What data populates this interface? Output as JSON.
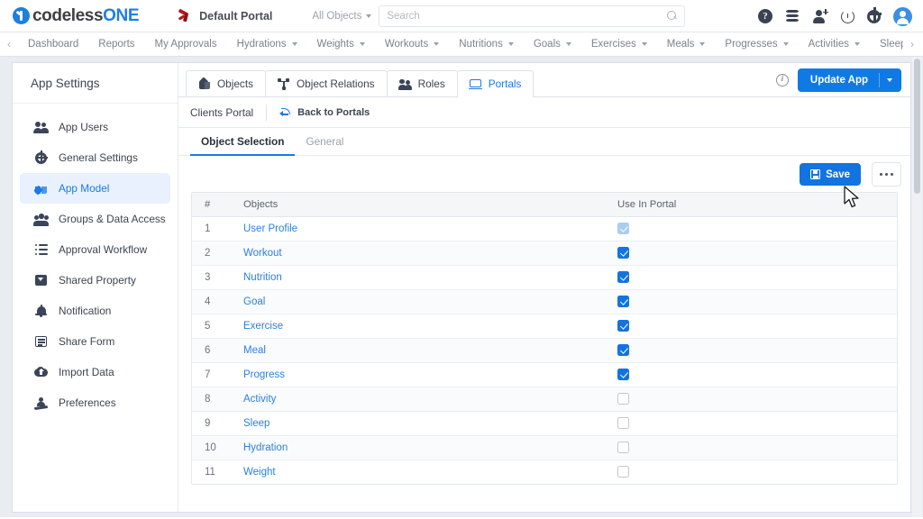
{
  "header": {
    "brand_prefix": "codeless",
    "brand_suffix": "ONE",
    "portal_name": "Default Portal",
    "scope_label": "All Objects",
    "search_placeholder": "Search",
    "search_value": "",
    "icons": [
      "help-icon",
      "database-icon",
      "add-user-icon",
      "history-icon",
      "gear-icon",
      "avatar-icon"
    ]
  },
  "nav": {
    "left_arrow": "‹",
    "right_arrow": "›",
    "items": [
      {
        "label": "Dashboard",
        "dropdown": false
      },
      {
        "label": "Reports",
        "dropdown": false
      },
      {
        "label": "My Approvals",
        "dropdown": false
      },
      {
        "label": "Hydrations",
        "dropdown": true
      },
      {
        "label": "Weights",
        "dropdown": true
      },
      {
        "label": "Workouts",
        "dropdown": true
      },
      {
        "label": "Nutritions",
        "dropdown": true
      },
      {
        "label": "Goals",
        "dropdown": true
      },
      {
        "label": "Exercises",
        "dropdown": true
      },
      {
        "label": "Meals",
        "dropdown": true
      },
      {
        "label": "Progresses",
        "dropdown": true
      },
      {
        "label": "Activities",
        "dropdown": true
      },
      {
        "label": "Sleeps",
        "dropdown": false
      }
    ]
  },
  "sidebar": {
    "title": "App Settings",
    "items": [
      {
        "label": "App Users",
        "icon": "users-icon",
        "active": false
      },
      {
        "label": "General Settings",
        "icon": "gear-icon",
        "active": false
      },
      {
        "label": "App Model",
        "icon": "cube-icon",
        "active": true
      },
      {
        "label": "Groups & Data Access",
        "icon": "groups-icon",
        "active": false
      },
      {
        "label": "Approval Workflow",
        "icon": "checklist-icon",
        "active": false
      },
      {
        "label": "Shared Property",
        "icon": "box-icon",
        "active": false
      },
      {
        "label": "Notification",
        "icon": "bell-icon",
        "active": false
      },
      {
        "label": "Share Form",
        "icon": "form-icon",
        "active": false
      },
      {
        "label": "Import Data",
        "icon": "cloud-upload-icon",
        "active": false
      },
      {
        "label": "Preferences",
        "icon": "preferences-icon",
        "active": false
      }
    ]
  },
  "main": {
    "tabs": [
      {
        "label": "Objects",
        "icon": "cube-icon",
        "active": false
      },
      {
        "label": "Object Relations",
        "icon": "relations-icon",
        "active": false
      },
      {
        "label": "Roles",
        "icon": "roles-icon",
        "active": false
      },
      {
        "label": "Portals",
        "icon": "portal-screen-icon",
        "active": true
      }
    ],
    "info_glyph": "i",
    "update_button": "Update App",
    "breadcrumb": {
      "current": "Clients Portal",
      "back_label": "Back to Portals"
    },
    "subtabs": [
      {
        "label": "Object Selection",
        "active": true
      },
      {
        "label": "General",
        "active": false
      }
    ],
    "toolbar": {
      "save_label": "Save",
      "more_label": "•••"
    },
    "table": {
      "columns": [
        "#",
        "Objects",
        "Use In Portal"
      ],
      "rows": [
        {
          "num": "1",
          "object": "User Profile",
          "checked": true,
          "disabled": true
        },
        {
          "num": "2",
          "object": "Workout",
          "checked": true,
          "disabled": false
        },
        {
          "num": "3",
          "object": "Nutrition",
          "checked": true,
          "disabled": false
        },
        {
          "num": "4",
          "object": "Goal",
          "checked": true,
          "disabled": false
        },
        {
          "num": "5",
          "object": "Exercise",
          "checked": true,
          "disabled": false
        },
        {
          "num": "6",
          "object": "Meal",
          "checked": true,
          "disabled": false
        },
        {
          "num": "7",
          "object": "Progress",
          "checked": true,
          "disabled": false
        },
        {
          "num": "8",
          "object": "Activity",
          "checked": false,
          "disabled": false
        },
        {
          "num": "9",
          "object": "Sleep",
          "checked": false,
          "disabled": false
        },
        {
          "num": "10",
          "object": "Hydration",
          "checked": false,
          "disabled": false
        },
        {
          "num": "11",
          "object": "Weight",
          "checked": false,
          "disabled": false
        }
      ]
    }
  },
  "colors": {
    "accent_blue": "#1274e0",
    "link_blue": "#2b7fe0",
    "brand_blue": "#1d7fe0",
    "portal_red": "#b4191c",
    "page_bg": "#e9ecf0",
    "header_bg": "#f4f6f8",
    "text_dark": "#3c4450",
    "text_muted": "#9aa2ac",
    "checkbox_disabled": "#a8cdf2"
  }
}
